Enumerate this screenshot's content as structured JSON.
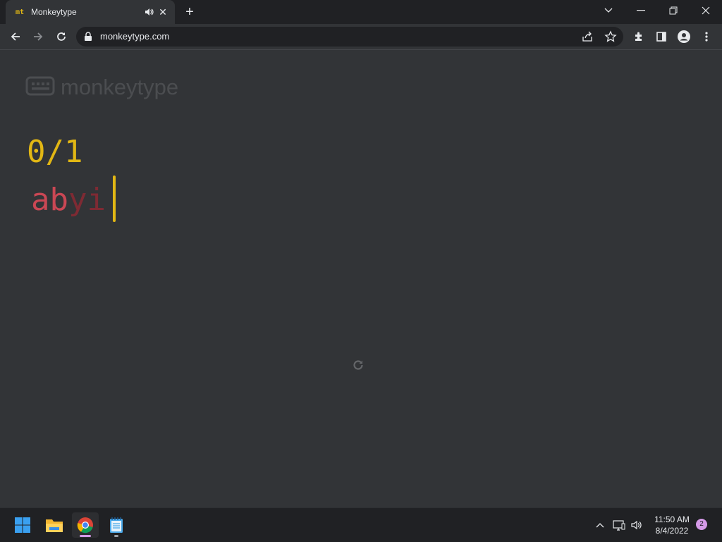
{
  "browser": {
    "tab_favicon": "mt",
    "tab_title": "Monkeytype",
    "url": "monkeytype.com"
  },
  "page": {
    "logo_text": "monkeytype",
    "counter": "0/1",
    "typed_chars": [
      {
        "char": "a",
        "state": "error"
      },
      {
        "char": "b",
        "state": "error"
      },
      {
        "char": "y",
        "state": "extra"
      },
      {
        "char": "i",
        "state": "extra"
      }
    ]
  },
  "taskbar": {
    "time": "11:50 AM",
    "date": "8/4/2022",
    "notification_count": "2"
  },
  "colors": {
    "background": "#323437",
    "accent": "#e2b714",
    "error": "#ca4754",
    "error_extra": "#7e2a33",
    "sub": "#646669"
  }
}
